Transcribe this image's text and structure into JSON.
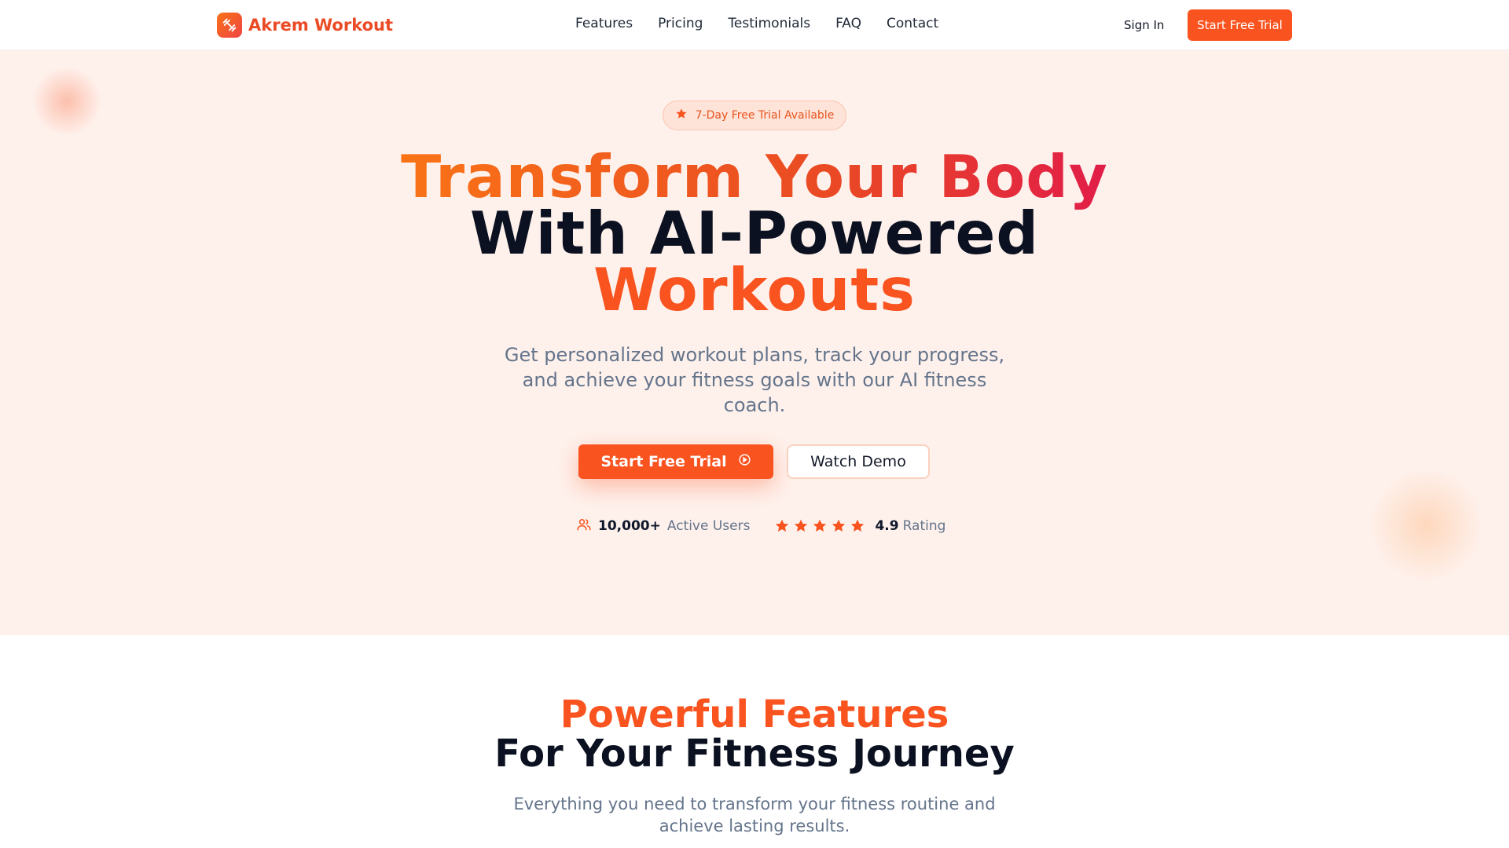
{
  "nav": {
    "brand": "Akrem Workout",
    "links": [
      "Features",
      "Pricing",
      "Testimonials",
      "FAQ",
      "Contact"
    ],
    "signin": "Sign In",
    "cta": "Start Free Trial"
  },
  "hero": {
    "badge": "7-Day Free Trial Available",
    "title_line1": "Transform Your Body",
    "title_line2": "With AI-Powered",
    "title_line3": "Workouts",
    "subtitle": "Get personalized workout plans, track your progress, and achieve your fitness goals with our AI fitness coach.",
    "primary_cta": "Start Free Trial",
    "secondary_cta": "Watch Demo",
    "users_count": "10,000+",
    "users_label": "Active Users",
    "rating_value": "4.9",
    "rating_label": "Rating",
    "stars": 5
  },
  "features": {
    "title_accent": "Powerful Features",
    "title_rest": "For Your Fitness Journey",
    "subtitle": "Everything you need to transform your fitness routine and achieve lasting results."
  },
  "colors": {
    "brand": "#f9531f",
    "hero_bg": "#fef1ec",
    "heading_dark": "#0b1120",
    "muted": "#64748b"
  },
  "icons": {
    "logo": "dumbbell-icon",
    "badge": "star-icon",
    "primary_cta": "play-circle-icon",
    "users": "users-icon",
    "rating": "star-icon"
  }
}
